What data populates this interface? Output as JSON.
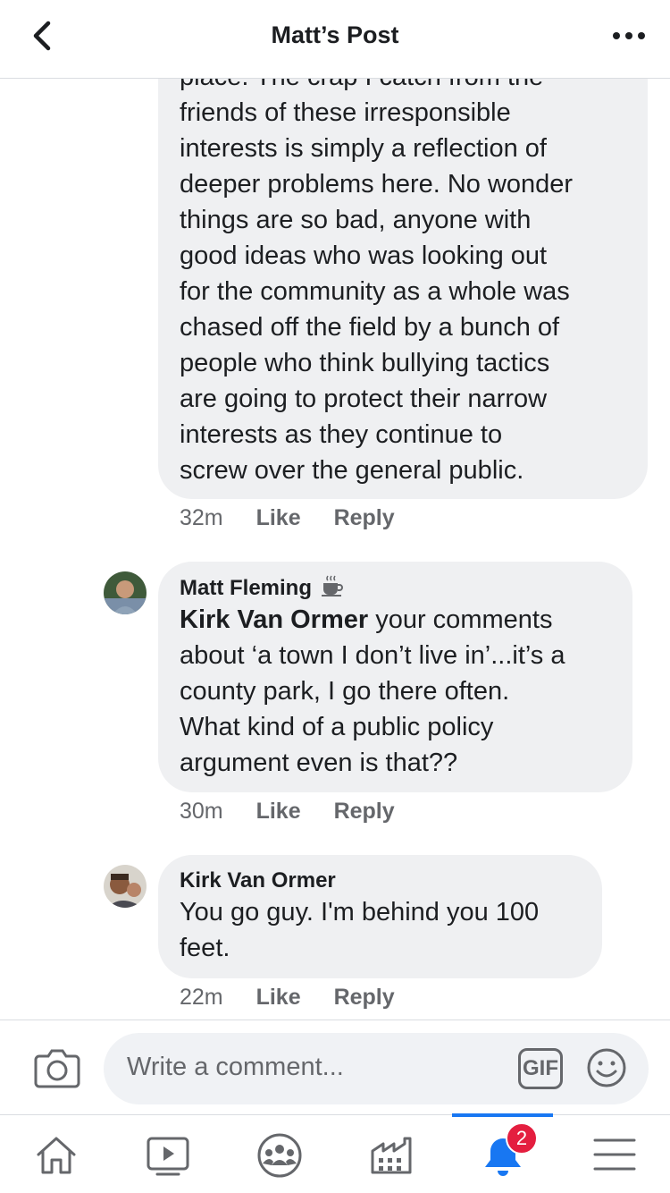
{
  "header": {
    "title": "Matt’s Post"
  },
  "comments": [
    {
      "partial_first_line": "place. The crap I catch from the",
      "text": "friends of these irresponsible\ninterests is simply a reflection of\ndeeper problems here. No wonder\nthings are so bad, anyone with\ngood ideas who was looking out\nfor the community as a whole was\nchased off the field by a bunch of\npeople who think bullying tactics\nare going to protect their narrow\ninterests as they continue to\nscrew over the general public.",
      "time": "32m",
      "like_label": "Like",
      "reply_label": "Reply"
    },
    {
      "author": "Matt Fleming",
      "author_badge_icon": "coffee-cup-icon",
      "mention": "Kirk Van Ormer",
      "text": " your comments\nabout ‘a town I don’t live in’...it’s a\ncounty park, I go there often.\nWhat kind of a public policy\nargument even is that??",
      "time": "30m",
      "like_label": "Like",
      "reply_label": "Reply"
    },
    {
      "author": "Kirk Van Ormer",
      "text": "You go guy. I'm behind you 100\nfeet.",
      "time": "22m",
      "like_label": "Like",
      "reply_label": "Reply"
    }
  ],
  "composer": {
    "placeholder": "Write a comment...",
    "gif_label": "GIF"
  },
  "tabbar": {
    "tabs": [
      "home-icon",
      "video-icon",
      "groups-icon",
      "marketplace-icon",
      "notifications-icon",
      "menu-icon"
    ],
    "active_tab": "notifications-icon",
    "notification_count": "2",
    "accent_color": "#1877f2",
    "badge_color": "#e41e3f"
  }
}
